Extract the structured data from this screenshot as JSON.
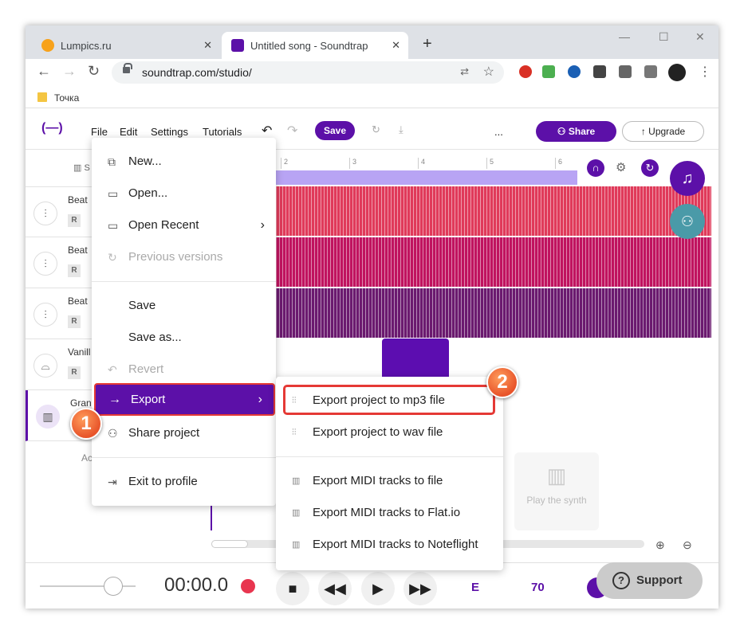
{
  "browser": {
    "tabs": [
      {
        "title": "Lumpics.ru"
      },
      {
        "title": "Untitled song - Soundtrap"
      }
    ],
    "url": "soundtrap.com/studio/",
    "bookmark": "Точка"
  },
  "studio": {
    "logo": "(—)",
    "menu": [
      "File",
      "Edit",
      "Settings",
      "Tutorials"
    ],
    "save_label": "Save",
    "ellipsis": "...",
    "share_label": "Share",
    "upgrade_label": "Upgrade",
    "ruler_ticks": [
      "2",
      "3",
      "4",
      "5",
      "6"
    ],
    "tracks": [
      {
        "name": "Beat",
        "badge": "R"
      },
      {
        "name": "Beat",
        "badge": "R"
      },
      {
        "name": "Beat",
        "badge": "R"
      },
      {
        "name": "Vanill",
        "badge": "R"
      },
      {
        "name": "Gran",
        "badge": ""
      }
    ],
    "add_label": "Ac",
    "synth_card": "Play the synth"
  },
  "file_menu": {
    "items": [
      "New...",
      "Open...",
      "Open Recent",
      "Previous versions",
      "Save",
      "Save as...",
      "Revert",
      "Export",
      "Share project",
      "Exit to profile"
    ]
  },
  "export_submenu": {
    "items": [
      "Export project to mp3 file",
      "Export project to wav file",
      "Export MIDI tracks to file",
      "Export MIDI tracks to Flat.io",
      "Export MIDI tracks to Noteflight"
    ]
  },
  "annotations": {
    "step1": "1",
    "step2": "2"
  },
  "transport": {
    "time": "00:00.0",
    "key": "E",
    "tempo": "70",
    "support_label": "Support"
  },
  "colors": {
    "accent": "#5c10a8",
    "highlight": "#e53935",
    "lane1": "#e03a5a",
    "lane2": "#c0135f",
    "lane3": "#6b1a6f"
  }
}
